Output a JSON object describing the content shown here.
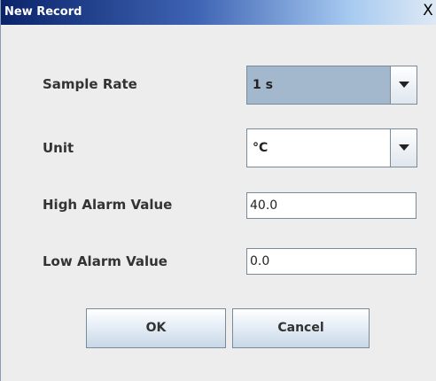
{
  "window": {
    "title": "New Record",
    "close_glyph": "X"
  },
  "form": {
    "sample_rate": {
      "label": "Sample Rate",
      "value": "1 s"
    },
    "unit": {
      "label": "Unit",
      "value": "°C"
    },
    "high_alarm": {
      "label": "High Alarm Value",
      "value": "40.0"
    },
    "low_alarm": {
      "label": "Low Alarm Value",
      "value": "0.0"
    }
  },
  "buttons": {
    "ok": "OK",
    "cancel": "Cancel"
  },
  "icons": {
    "close": "close-icon",
    "dropdown": "chevron-down-icon"
  },
  "colors": {
    "title_start": "#0a246a",
    "title_end": "#dfe9f5",
    "selected_combo": "#a3b8cc",
    "dialog_bg": "#ededed"
  }
}
